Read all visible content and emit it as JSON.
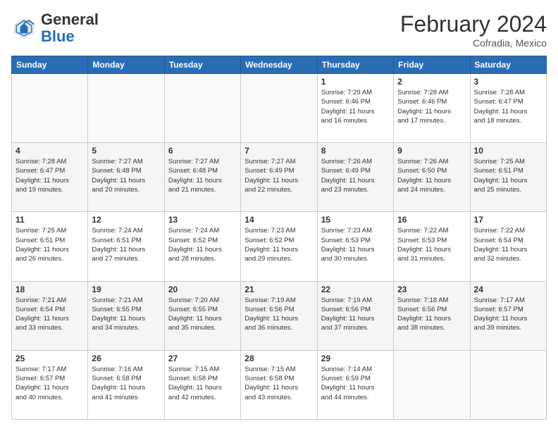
{
  "header": {
    "logo_general": "General",
    "logo_blue": "Blue",
    "month_title": "February 2024",
    "location": "Cofradia, Mexico"
  },
  "days_of_week": [
    "Sunday",
    "Monday",
    "Tuesday",
    "Wednesday",
    "Thursday",
    "Friday",
    "Saturday"
  ],
  "weeks": [
    {
      "shade": "white",
      "days": [
        {
          "number": "",
          "info": ""
        },
        {
          "number": "",
          "info": ""
        },
        {
          "number": "",
          "info": ""
        },
        {
          "number": "",
          "info": ""
        },
        {
          "number": "1",
          "info": "Sunrise: 7:29 AM\nSunset: 6:46 PM\nDaylight: 11 hours\nand 16 minutes."
        },
        {
          "number": "2",
          "info": "Sunrise: 7:28 AM\nSunset: 6:46 PM\nDaylight: 11 hours\nand 17 minutes."
        },
        {
          "number": "3",
          "info": "Sunrise: 7:28 AM\nSunset: 6:47 PM\nDaylight: 11 hours\nand 18 minutes."
        }
      ]
    },
    {
      "shade": "shade",
      "days": [
        {
          "number": "4",
          "info": "Sunrise: 7:28 AM\nSunset: 6:47 PM\nDaylight: 11 hours\nand 19 minutes."
        },
        {
          "number": "5",
          "info": "Sunrise: 7:27 AM\nSunset: 6:48 PM\nDaylight: 11 hours\nand 20 minutes."
        },
        {
          "number": "6",
          "info": "Sunrise: 7:27 AM\nSunset: 6:48 PM\nDaylight: 11 hours\nand 21 minutes."
        },
        {
          "number": "7",
          "info": "Sunrise: 7:27 AM\nSunset: 6:49 PM\nDaylight: 11 hours\nand 22 minutes."
        },
        {
          "number": "8",
          "info": "Sunrise: 7:26 AM\nSunset: 6:49 PM\nDaylight: 11 hours\nand 23 minutes."
        },
        {
          "number": "9",
          "info": "Sunrise: 7:26 AM\nSunset: 6:50 PM\nDaylight: 11 hours\nand 24 minutes."
        },
        {
          "number": "10",
          "info": "Sunrise: 7:25 AM\nSunset: 6:51 PM\nDaylight: 11 hours\nand 25 minutes."
        }
      ]
    },
    {
      "shade": "white",
      "days": [
        {
          "number": "11",
          "info": "Sunrise: 7:25 AM\nSunset: 6:51 PM\nDaylight: 11 hours\nand 26 minutes."
        },
        {
          "number": "12",
          "info": "Sunrise: 7:24 AM\nSunset: 6:51 PM\nDaylight: 11 hours\nand 27 minutes."
        },
        {
          "number": "13",
          "info": "Sunrise: 7:24 AM\nSunset: 6:52 PM\nDaylight: 11 hours\nand 28 minutes."
        },
        {
          "number": "14",
          "info": "Sunrise: 7:23 AM\nSunset: 6:52 PM\nDaylight: 11 hours\nand 29 minutes."
        },
        {
          "number": "15",
          "info": "Sunrise: 7:23 AM\nSunset: 6:53 PM\nDaylight: 11 hours\nand 30 minutes."
        },
        {
          "number": "16",
          "info": "Sunrise: 7:22 AM\nSunset: 6:53 PM\nDaylight: 11 hours\nand 31 minutes."
        },
        {
          "number": "17",
          "info": "Sunrise: 7:22 AM\nSunset: 6:54 PM\nDaylight: 11 hours\nand 32 minutes."
        }
      ]
    },
    {
      "shade": "shade",
      "days": [
        {
          "number": "18",
          "info": "Sunrise: 7:21 AM\nSunset: 6:54 PM\nDaylight: 11 hours\nand 33 minutes."
        },
        {
          "number": "19",
          "info": "Sunrise: 7:21 AM\nSunset: 6:55 PM\nDaylight: 11 hours\nand 34 minutes."
        },
        {
          "number": "20",
          "info": "Sunrise: 7:20 AM\nSunset: 6:55 PM\nDaylight: 11 hours\nand 35 minutes."
        },
        {
          "number": "21",
          "info": "Sunrise: 7:19 AM\nSunset: 6:56 PM\nDaylight: 11 hours\nand 36 minutes."
        },
        {
          "number": "22",
          "info": "Sunrise: 7:19 AM\nSunset: 6:56 PM\nDaylight: 11 hours\nand 37 minutes."
        },
        {
          "number": "23",
          "info": "Sunrise: 7:18 AM\nSunset: 6:56 PM\nDaylight: 11 hours\nand 38 minutes."
        },
        {
          "number": "24",
          "info": "Sunrise: 7:17 AM\nSunset: 6:57 PM\nDaylight: 11 hours\nand 39 minutes."
        }
      ]
    },
    {
      "shade": "white",
      "days": [
        {
          "number": "25",
          "info": "Sunrise: 7:17 AM\nSunset: 6:57 PM\nDaylight: 11 hours\nand 40 minutes."
        },
        {
          "number": "26",
          "info": "Sunrise: 7:16 AM\nSunset: 6:58 PM\nDaylight: 11 hours\nand 41 minutes."
        },
        {
          "number": "27",
          "info": "Sunrise: 7:15 AM\nSunset: 6:58 PM\nDaylight: 11 hours\nand 42 minutes."
        },
        {
          "number": "28",
          "info": "Sunrise: 7:15 AM\nSunset: 6:58 PM\nDaylight: 11 hours\nand 43 minutes."
        },
        {
          "number": "29",
          "info": "Sunrise: 7:14 AM\nSunset: 6:59 PM\nDaylight: 11 hours\nand 44 minutes."
        },
        {
          "number": "",
          "info": ""
        },
        {
          "number": "",
          "info": ""
        }
      ]
    }
  ]
}
